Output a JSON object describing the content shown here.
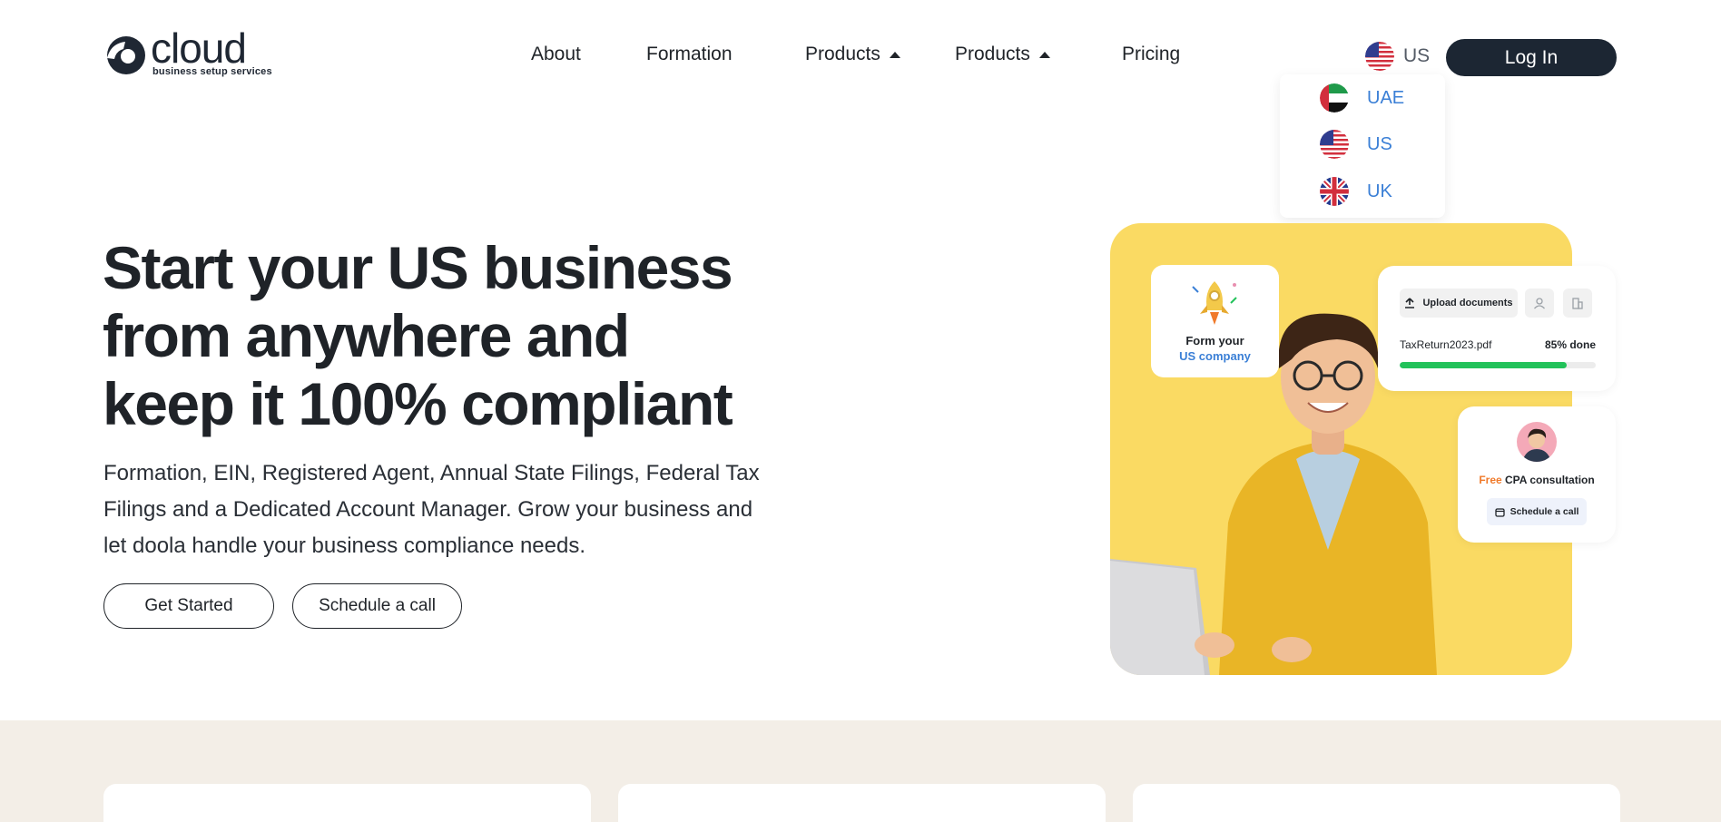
{
  "brand": {
    "name": "cloud",
    "tagline": "business setup services"
  },
  "nav": {
    "about": "About",
    "formation": "Formation",
    "products_1": "Products",
    "products_2": "Products",
    "pricing": "Pricing"
  },
  "language": {
    "current": "US",
    "options": [
      "UAE",
      "US",
      "UK"
    ]
  },
  "login_label": "Log In",
  "hero": {
    "title_line1": "Start your US business",
    "title_line2": "from anywhere and",
    "title_line3": "keep it 100% compliant",
    "desc_line1": "Formation, EIN, Registered Agent, Annual State Filings, Federal Tax",
    "desc_line2": "Filings and a Dedicated Account Manager. Grow your business and",
    "desc_line3": "let doola handle your business compliance needs.",
    "cta_primary": "Get Started",
    "cta_secondary": "Schedule a call"
  },
  "form_card": {
    "line1": "Form your",
    "line2": "US company"
  },
  "upload_card": {
    "button": "Upload documents",
    "file": "TaxReturn2023.pdf",
    "status": "85% done",
    "progress": 0.85
  },
  "cpa_card": {
    "free": "Free",
    "title": "CPA consultation",
    "button": "Schedule a call"
  },
  "colors": {
    "dark": "#1c2633",
    "accent_blue": "#3a7fd6",
    "yellow": "#fada63",
    "green": "#22c25a",
    "orange": "#f07a2a",
    "band": "#f3eee7"
  }
}
